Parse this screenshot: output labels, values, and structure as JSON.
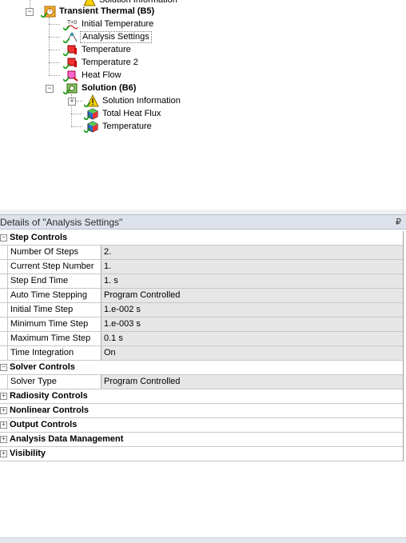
{
  "tree": {
    "top_partial": "Solution Information",
    "transient_thermal": "Transient Thermal (B5)",
    "initial_temperature": "Initial Temperature",
    "analysis_settings": "Analysis Settings",
    "temperature": "Temperature",
    "temperature2": "Temperature 2",
    "heat_flow": "Heat Flow",
    "solution": "Solution (B6)",
    "solution_information": "Solution Information",
    "total_heat_flux": "Total Heat Flux",
    "solution_temperature": "Temperature"
  },
  "details": {
    "title": "Details of \"Analysis Settings\"",
    "pin": "₽",
    "step_controls": {
      "label": "Step Controls",
      "rows": [
        {
          "name": "Number Of Steps",
          "value": "2."
        },
        {
          "name": "Current Step Number",
          "value": "1."
        },
        {
          "name": "Step End Time",
          "value": "1. s"
        },
        {
          "name": "Auto Time Stepping",
          "value": "Program Controlled"
        },
        {
          "name": "Initial Time Step",
          "value": "1.e-002 s"
        },
        {
          "name": "Minimum Time Step",
          "value": "1.e-003 s"
        },
        {
          "name": "Maximum Time Step",
          "value": "0.1 s"
        },
        {
          "name": "Time Integration",
          "value": "On"
        }
      ]
    },
    "solver_controls": {
      "label": "Solver Controls",
      "rows": [
        {
          "name": "Solver Type",
          "value": "Program Controlled"
        }
      ]
    },
    "radiosity_controls": "Radiosity Controls",
    "nonlinear_controls": "Nonlinear Controls",
    "output_controls": "Output Controls",
    "analysis_data_management": "Analysis Data Management",
    "visibility": "Visibility",
    "collapse_symbol": "−",
    "expand_symbol": "+"
  }
}
